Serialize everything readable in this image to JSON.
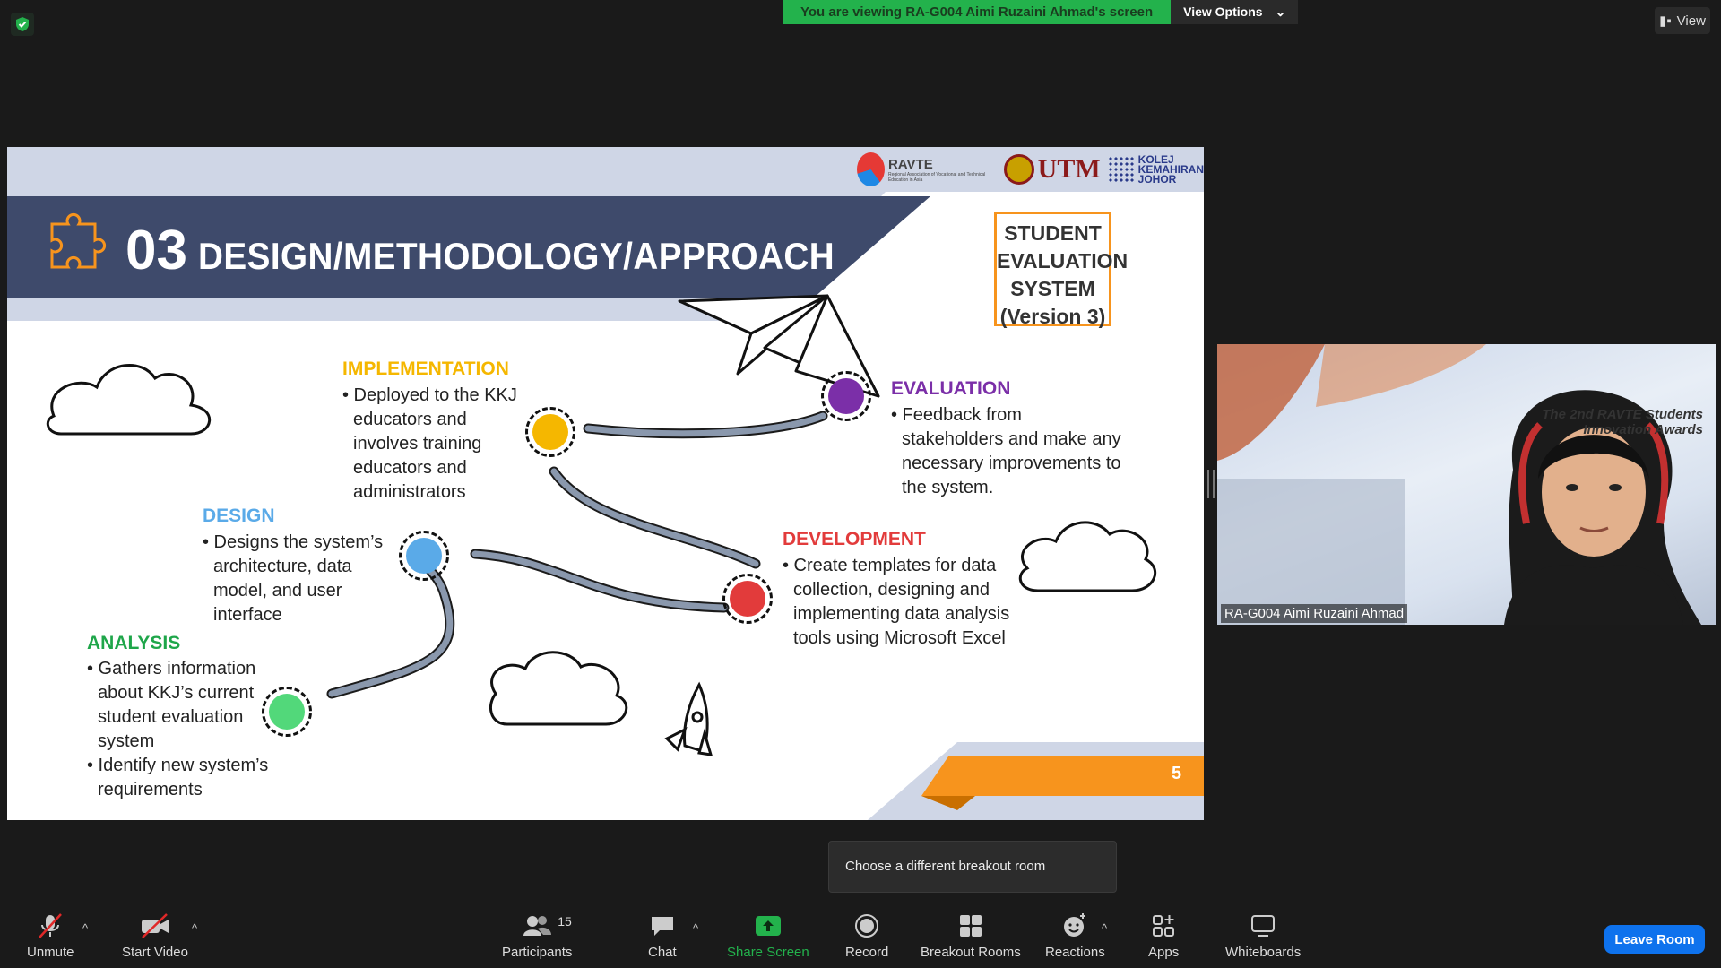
{
  "top": {
    "banner_text": "You are viewing RA-G004 Aimi Ruzaini Ahmad's screen",
    "view_options_label": "View Options",
    "view_label": "View"
  },
  "slide": {
    "section_number": "03",
    "section_title": "DESIGN/METHODOLOGY/APPROACH",
    "logos": {
      "ravte": "RAVTE",
      "ravte_sub": "Regional Association of Vocational and Technical Education in Asia",
      "utm": "UTM",
      "kkj_lines": [
        "KOLEJ",
        "KEMAHIRAN",
        "JOHOR"
      ]
    },
    "system_box": [
      "STUDENT",
      "EVALUATION",
      "SYSTEM",
      "(Version 3)"
    ],
    "stages": {
      "implementation": {
        "title": "IMPLEMENTATION",
        "color": "#f5b700",
        "bullets": [
          "• Deployed to the KKJ educators and involves training educators and administrators"
        ]
      },
      "evaluation": {
        "title": "EVALUATION",
        "color": "#7b2fa8",
        "bullets": [
          "• Feedback from stakeholders and make any necessary improvements to the system."
        ]
      },
      "design": {
        "title": "DESIGN",
        "color": "#5aaae8",
        "bullets": [
          "• Designs the system’s architecture, data model, and user interface"
        ]
      },
      "development": {
        "title": "DEVELOPMENT",
        "color": "#e23b3b",
        "bullets": [
          "• Create templates for data collection, designing and implementing data analysis tools using Microsoft Excel"
        ]
      },
      "analysis": {
        "title": "ANALYSIS",
        "color": "#1fa64a",
        "bullets": [
          "• Gathers information about KKJ’s current student evaluation system",
          "• Identify new system’s requirements"
        ]
      }
    },
    "page_number": "5"
  },
  "video": {
    "participant_name": "RA-G004 Aimi Ruzaini Ahmad",
    "backdrop_text": "The 2nd RAVTE Students Innovation Awards"
  },
  "tooltip": "Choose a different breakout room",
  "toolbar": {
    "unmute": "Unmute",
    "start_video": "Start Video",
    "participants": "Participants",
    "participants_count": "15",
    "chat": "Chat",
    "share_screen": "Share Screen",
    "record": "Record",
    "breakout_rooms": "Breakout Rooms",
    "reactions": "Reactions",
    "apps": "Apps",
    "whiteboards": "Whiteboards",
    "leave": "Leave Room"
  },
  "colors": {
    "zoom_green": "#23b24c",
    "leave_blue": "#0e72ed",
    "slide_navy": "#3e4a6b",
    "slide_orange": "#f7941d"
  }
}
